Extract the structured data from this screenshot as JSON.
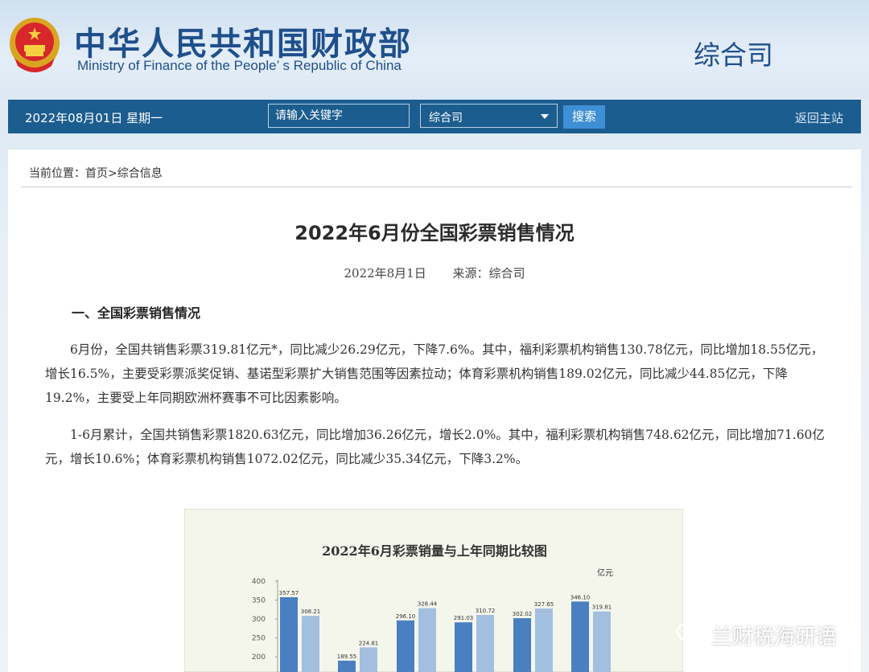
{
  "header": {
    "title_cn": "中华人民共和国财政部",
    "title_en": "Ministry of Finance of the People’ s Republic of China",
    "department": "综合司"
  },
  "navbar": {
    "date": "2022年08月01日  星期一",
    "search_placeholder": "请输入关键字",
    "select_value": "综合司",
    "search_button": "搜索",
    "home_link": "返回主站"
  },
  "breadcrumb": {
    "label": "当前位置：",
    "home": "首页",
    "sep": ">",
    "current": "综合信息"
  },
  "article": {
    "title": "2022年6月份全国彩票销售情况",
    "date": "2022年8月1日",
    "source": "来源：综合司",
    "section1": "一、全国彩票销售情况",
    "para1": "6月份，全国共销售彩票319.81亿元*，同比减少26.29亿元，下降7.6%。其中，福利彩票机构销售130.78亿元，同比增加18.55亿元，增长16.5%，主要受彩票派奖促销、基诺型彩票扩大销售范围等因素拉动；体育彩票机构销售189.02亿元，同比减少44.85亿元，下降19.2%，主要受上年同期欧洲杯赛事不可比因素影响。",
    "para2": "1-6月累计，全国共销售彩票1820.63亿元，同比增加36.26亿元，增长2.0%。其中，福利彩票机构销售748.62亿元，同比增加71.60亿元，增长10.6%；体育彩票机构销售1072.02亿元，同比减少35.34亿元，下降3.2%。"
  },
  "chart_data": {
    "type": "bar",
    "title": "2022年6月彩票销量与上年同期比较图",
    "unit": "亿元",
    "ylim": [
      0,
      400
    ],
    "yticks": [
      200,
      250,
      300,
      350,
      400
    ],
    "series": [
      {
        "values": [
          357.57,
          189.55,
          296.1,
          291.03,
          302.02,
          346.1
        ]
      },
      {
        "values": [
          308.21,
          224.81,
          328.44,
          310.72,
          327.65,
          319.81
        ]
      }
    ],
    "colors": [
      "#4a7fc1",
      "#a3bfe0"
    ]
  },
  "watermark": {
    "text": "兰财税海研语"
  },
  "colors": {
    "nav_bg": "#1c5d8f",
    "brand_blue": "#1f4f8c",
    "button_blue": "#3f8fd6"
  }
}
